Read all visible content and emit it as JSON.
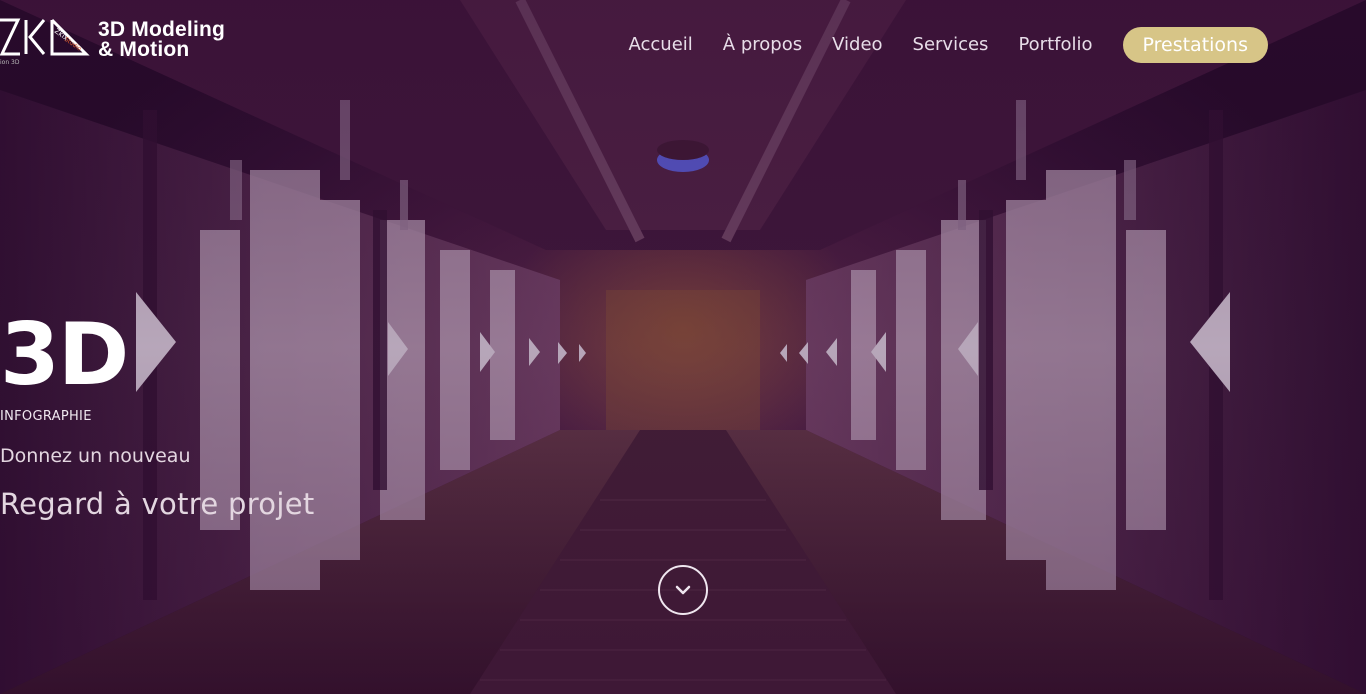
{
  "brand": {
    "line1": "3D Modeling",
    "line2": "& Motion"
  },
  "nav": {
    "items": [
      {
        "label": "Accueil"
      },
      {
        "label": "À propos"
      },
      {
        "label": "Video"
      },
      {
        "label": "Services"
      },
      {
        "label": "Portfolio"
      }
    ],
    "cta": "Prestations"
  },
  "hero": {
    "title": "3D",
    "subtitle": "INFOGRAPHIE",
    "tagline_top": "Donnez un nouveau",
    "tagline_bottom": "Regard à votre projet",
    "scroll_icon": "chevron-down-icon"
  },
  "colors": {
    "cta_background": "#d7c587",
    "text": "#ffffff",
    "background": "#3d1838"
  }
}
